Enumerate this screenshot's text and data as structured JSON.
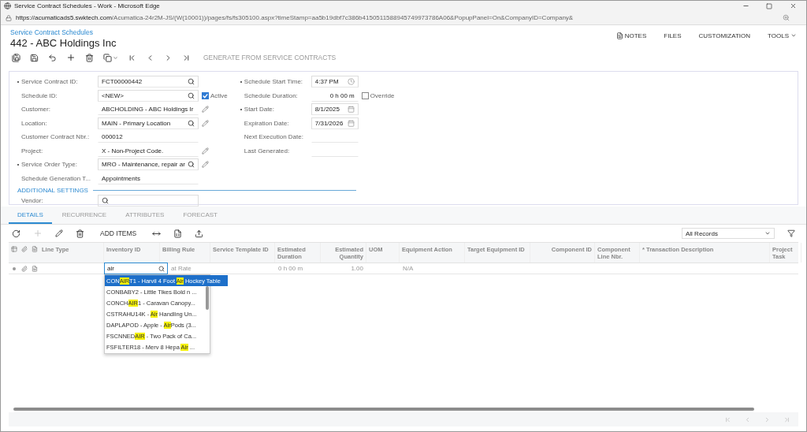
{
  "window": {
    "title": "Service Contract Schedules - Work - Microsoft Edge"
  },
  "address_bar": {
    "host": "https://acumaticads5.swktech.com",
    "path": "/Acumatica-24r2M-JS/(W(10001))/pages/fs/fs305100.aspx?timeStamp=aa5b19dbf7c386b4150511588945749973786A06&PopupPanel=On&CompanyID=Company&"
  },
  "header": {
    "breadcrumb": "Service Contract Schedules",
    "title": "442 - ABC Holdings Inc",
    "links": [
      {
        "kind": "notes",
        "label": "NOTES"
      },
      {
        "kind": "plain",
        "label": "FILES"
      },
      {
        "kind": "plain",
        "label": "CUSTOMIZATION"
      },
      {
        "kind": "menu",
        "label": "TOOLS"
      }
    ]
  },
  "toolbar": [
    {
      "kind": "save-close",
      "disabled": false
    },
    {
      "kind": "save",
      "disabled": false
    },
    {
      "kind": "undo",
      "disabled": false
    },
    {
      "kind": "add",
      "disabled": false
    },
    {
      "kind": "delete",
      "disabled": false
    },
    {
      "kind": "copy",
      "disabled": false
    },
    {
      "kind": "first",
      "disabled": false
    },
    {
      "kind": "prev",
      "disabled": false
    },
    {
      "kind": "next",
      "disabled": false
    },
    {
      "kind": "last",
      "disabled": false
    },
    {
      "kind": "text",
      "label": "GENERATE FROM SERVICE CONTRACTS",
      "disabled": true
    }
  ],
  "form": {
    "left": [
      {
        "label": "Service Contract ID:",
        "required": true,
        "kind": "lookup",
        "value": "FCT00000442"
      },
      {
        "label": "Schedule ID:",
        "required": false,
        "kind": "lookup",
        "value": "<NEW>",
        "checkbox": {
          "label": "Active",
          "checked": true
        }
      },
      {
        "label": "Customer:",
        "required": false,
        "kind": "plain-edit",
        "value": "ABCHOLDING - ABC Holdings Ir"
      },
      {
        "label": "Location:",
        "required": false,
        "kind": "lookup-edit",
        "value": "MAIN - Primary Location"
      },
      {
        "label": "Customer Contract Nbr.:",
        "required": false,
        "kind": "plain",
        "value": "000012"
      },
      {
        "label": "Project:",
        "required": false,
        "kind": "plain-edit",
        "value": "X - Non-Project Code."
      },
      {
        "label": "Service Order Type:",
        "required": true,
        "kind": "lookup-edit",
        "value": "MRO - Maintenance, repair ar"
      },
      {
        "label": "Schedule Generation T...",
        "required": false,
        "kind": "plain",
        "value": "Appointments"
      }
    ],
    "right": [
      {
        "label": "Schedule Start Time:",
        "required": true,
        "kind": "time",
        "value": "4:37 PM"
      },
      {
        "label": "Schedule Duration:",
        "required": false,
        "kind": "number",
        "value": "0 h 00 m",
        "checkbox": {
          "label": "Override",
          "checked": false
        }
      },
      {
        "label": "Start Date:",
        "required": true,
        "kind": "date",
        "value": "8/1/2025"
      },
      {
        "label": "Expiration Date:",
        "required": false,
        "kind": "date",
        "value": "7/31/2026"
      },
      {
        "label": "Next Execution Date:",
        "required": false,
        "kind": "empty"
      },
      {
        "label": "Last Generated:",
        "required": false,
        "kind": "empty"
      }
    ],
    "section": "ADDITIONAL SETTINGS",
    "extra": [
      {
        "label": "Vendor:",
        "required": false,
        "kind": "lookup"
      }
    ]
  },
  "tabs": [
    {
      "label": "DETAILS",
      "selected": true
    },
    {
      "label": "RECURRENCE",
      "selected": false
    },
    {
      "label": "ATTRIBUTES",
      "selected": false
    },
    {
      "label": "FORECAST",
      "selected": false
    }
  ],
  "grid_toolbar": {
    "items": [
      {
        "kind": "refresh",
        "disabled": false
      },
      {
        "kind": "add",
        "disabled": true
      },
      {
        "kind": "edit",
        "disabled": false
      },
      {
        "kind": "delete",
        "disabled": false
      },
      {
        "kind": "text",
        "label": "ADD ITEMS",
        "disabled": false
      },
      {
        "kind": "fit",
        "disabled": false
      },
      {
        "kind": "excel",
        "disabled": false
      },
      {
        "kind": "upload",
        "disabled": false
      }
    ],
    "filter": "All Records"
  },
  "table": {
    "columns": [
      {
        "label": "Line Type"
      },
      {
        "label": "Inventory ID"
      },
      {
        "label": "Billing Rule"
      },
      {
        "label": "Service Template ID"
      },
      {
        "label": "Estimated Duration"
      },
      {
        "label": "Estimated Quantity"
      },
      {
        "label": "UOM"
      },
      {
        "label": "Equipment Action"
      },
      {
        "label": "Target Equipment ID"
      },
      {
        "label": "Component ID"
      },
      {
        "label": "Component Line Nbr."
      },
      {
        "label": "* Transaction Description"
      },
      {
        "label": "Project Task"
      }
    ],
    "rows": [
      {
        "cells": [
          "",
          "air",
          "at Rate",
          "",
          "0 h 00 m",
          "1.00",
          "",
          "N/A",
          "",
          "",
          "",
          "",
          ""
        ]
      }
    ],
    "suggestions": [
      {
        "selected": true,
        "parts": [
          {
            "text": "CON",
            "match": false
          },
          {
            "text": "AIR",
            "match": true
          },
          {
            "text": "T1 - Harvil 4 Foot ",
            "match": false
          },
          {
            "text": "Air",
            "match": true
          },
          {
            "text": " Hockey Table",
            "match": false
          }
        ]
      },
      {
        "selected": false,
        "parts": [
          {
            "text": "CONBABY2 - Little Tikes Bold n ...",
            "match": false
          }
        ]
      },
      {
        "selected": false,
        "parts": [
          {
            "text": "CONCH",
            "match": false
          },
          {
            "text": "AIR",
            "match": true
          },
          {
            "text": "1 - Caravan Canopy...",
            "match": false
          }
        ]
      },
      {
        "selected": false,
        "parts": [
          {
            "text": "CSTRAHU14K - ",
            "match": false
          },
          {
            "text": "Air",
            "match": true
          },
          {
            "text": " Handling Un...",
            "match": false
          }
        ]
      },
      {
        "selected": false,
        "parts": [
          {
            "text": "DAPLAPOD - Apple - ",
            "match": false
          },
          {
            "text": "Air",
            "match": true
          },
          {
            "text": "Pods (3...",
            "match": false
          }
        ]
      },
      {
        "selected": false,
        "parts": [
          {
            "text": "FSCNNED",
            "match": false
          },
          {
            "text": "AIR",
            "match": true
          },
          {
            "text": " - Two Pack of Ca...",
            "match": false
          }
        ]
      },
      {
        "selected": false,
        "parts": [
          {
            "text": "FSFILTER18 - Merv 8 Hepa ",
            "match": false
          },
          {
            "text": "Air",
            "match": true
          },
          {
            "text": " ...",
            "match": false
          }
        ]
      }
    ]
  }
}
